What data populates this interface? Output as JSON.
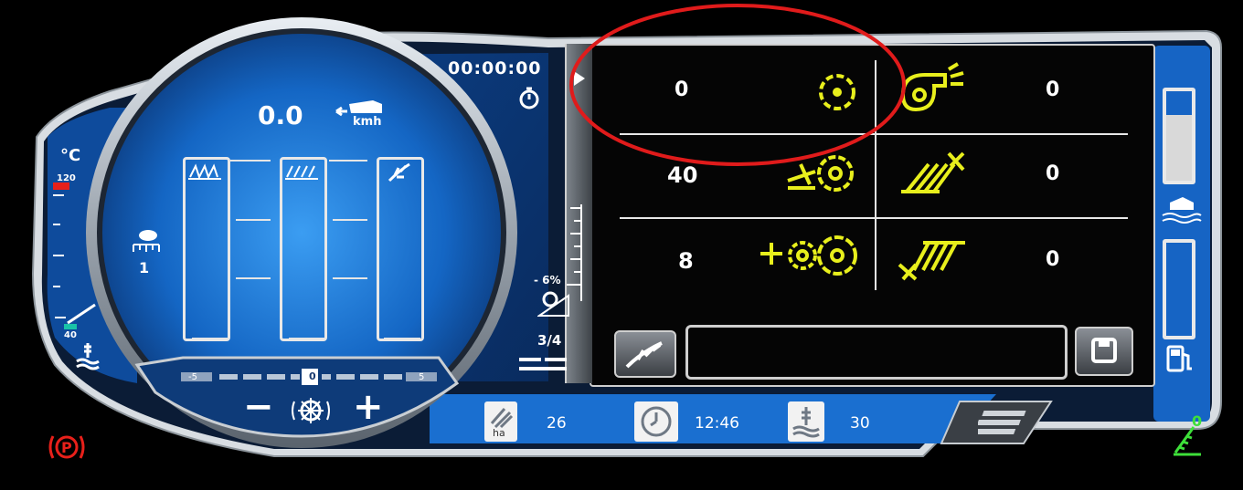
{
  "timer": {
    "value": "00:00:00"
  },
  "speed": {
    "value": "0.0",
    "unit": "kmh"
  },
  "temperature": {
    "unit": "°C",
    "max_label": "120",
    "min_label": "40"
  },
  "left_widget": {
    "value": "1"
  },
  "incline": {
    "value": "- 6%"
  },
  "gear": {
    "value": "3/4"
  },
  "concave_scale": {
    "left": "-5",
    "center": "0",
    "right": "5"
  },
  "concave_controls": {
    "minus": "−",
    "plus": "+"
  },
  "settings_grid": {
    "rows": [
      {
        "left_value": "0",
        "right_value": "0"
      },
      {
        "left_value": "40",
        "right_value": "0"
      },
      {
        "left_value": "8",
        "right_value": "0"
      }
    ]
  },
  "status_bar": {
    "area_unit": "ha",
    "area_value": "26",
    "clock_value": "12:46",
    "temp_value": "30"
  },
  "right_indicator": {
    "value": "0"
  },
  "colors": {
    "accent_yellow": "#e8ef1c",
    "blue": "#1a6fd0",
    "park_red": "#e8201a",
    "green": "#3ee03a",
    "annotation_red": "#e01b1b"
  },
  "icons": [
    "rotor-icon",
    "fan-icon",
    "rotor-chopper-icon",
    "sieve-upper-icon",
    "rotor-thresher-icon",
    "sieve-lower-icon",
    "harvester-speed-icon",
    "crop-icon",
    "save-icon",
    "area-icon",
    "clock-icon",
    "coolant-temp-icon",
    "fuel-icon",
    "water-level-icon",
    "parking-brake-icon",
    "wiper-icon",
    "menu-icon",
    "stopwatch-icon"
  ]
}
